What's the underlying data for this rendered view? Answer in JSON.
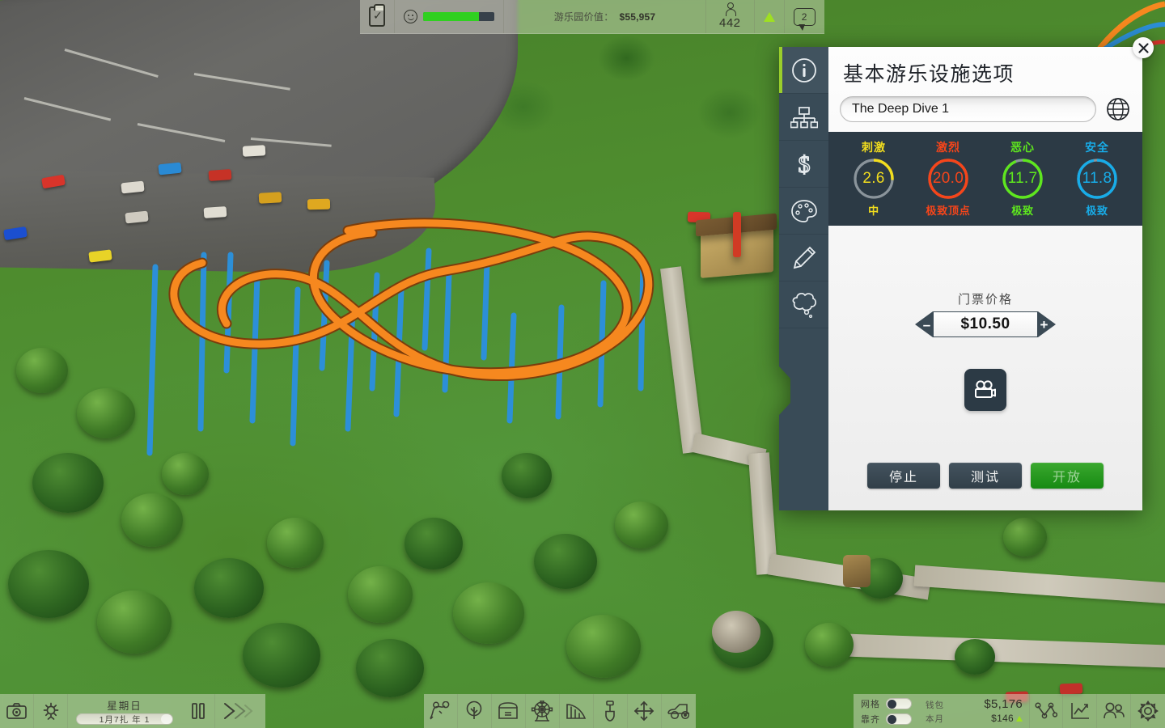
{
  "hud": {
    "checklist_icon": "clipboard-check-icon",
    "happiness_icon": "smiley-icon",
    "happiness_percent": 78,
    "park_value_label": "游乐园价值：",
    "park_value": "$55,957",
    "guest_icon": "person-icon",
    "guest_count": "442",
    "warning_icon": "warning-triangle-icon",
    "message_icon": "speech-bubble-icon",
    "message_count": "2"
  },
  "panel": {
    "title": "基本游乐设施选项",
    "close_icon": "close-icon",
    "tabs": [
      {
        "name": "info",
        "icon": "info-circle-icon",
        "active": true
      },
      {
        "name": "structure",
        "icon": "hierarchy-icon",
        "active": false
      },
      {
        "name": "finance",
        "icon": "dollar-icon",
        "active": false
      },
      {
        "name": "appearance",
        "icon": "palette-icon",
        "active": false
      },
      {
        "name": "customise",
        "icon": "pencil-icon",
        "active": false
      },
      {
        "name": "thoughts",
        "icon": "thought-bubble-icon",
        "active": false
      }
    ],
    "ride_name": "The Deep Dive 1",
    "ride_name_placeholder": "The Deep Dive 1",
    "globe_icon": "globe-icon",
    "stats": [
      {
        "label": "刺激",
        "value": "2.6",
        "sub": "中",
        "color": "#f2dd1e",
        "percent": 26
      },
      {
        "label": "激烈",
        "value": "20.0",
        "sub": "极致顶点",
        "color": "#f6451a",
        "percent": 100
      },
      {
        "label": "恶心",
        "value": "11.7",
        "sub": "极致",
        "color": "#5ee61e",
        "percent": 94
      },
      {
        "label": "安全",
        "value": "11.8",
        "sub": "极致",
        "color": "#18ace8",
        "percent": 97
      }
    ],
    "price_label": "门票价格",
    "price_value": "$10.50",
    "price_minus": "–",
    "price_plus": "+",
    "video_icon": "movie-camera-icon",
    "buttons": [
      {
        "label": "停止",
        "style": "dark"
      },
      {
        "label": "测试",
        "style": "dark"
      },
      {
        "label": "开放",
        "style": "green"
      }
    ]
  },
  "taskbar": {
    "screenshot_icon": "camera-icon",
    "brightness_icon": "sun-icon",
    "weekday": "星期日",
    "date": "1月7扎    年   1",
    "pause_icon": "pause-icon",
    "fastforward_icon": "fast-forward-icon",
    "tools": [
      {
        "name": "path",
        "icon": "path-icon"
      },
      {
        "name": "scenery",
        "icon": "tree-icon"
      },
      {
        "name": "shops",
        "icon": "shop-stall-icon"
      },
      {
        "name": "flat-rides",
        "icon": "ferris-wheel-icon"
      },
      {
        "name": "coasters",
        "icon": "coaster-slope-icon"
      },
      {
        "name": "terrain",
        "icon": "shovel-icon"
      },
      {
        "name": "move",
        "icon": "move-arrows-icon"
      },
      {
        "name": "vehicles",
        "icon": "vehicle-icon"
      }
    ],
    "grid_label": "网格",
    "grid_on": false,
    "snap_label": "靠齐",
    "snap_on": false,
    "wallet_label": "钱包",
    "wallet_value": "$5,176",
    "month_label": "本月",
    "month_value": "$146",
    "month_trend_icon": "trend-up-triangle-icon",
    "right_tools": [
      {
        "name": "connections",
        "icon": "node-graph-icon"
      },
      {
        "name": "statistics",
        "icon": "chart-line-icon"
      },
      {
        "name": "staff",
        "icon": "people-icon"
      },
      {
        "name": "settings",
        "icon": "gear-icon"
      }
    ]
  }
}
